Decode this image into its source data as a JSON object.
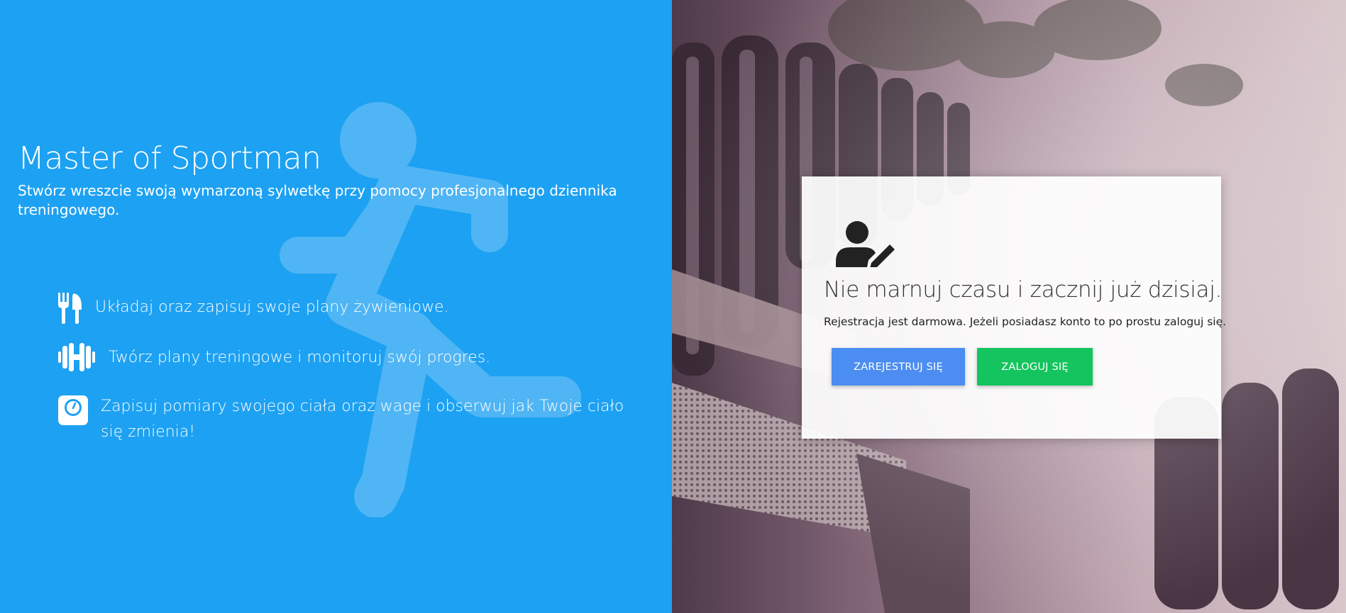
{
  "hero": {
    "title": "Master of Sportman",
    "subtitle": "Stwórz wreszcie swoją wymarzoną sylwetkę przy pomocy profesjonalnego dziennika treningowego."
  },
  "features": [
    {
      "icon": "cutlery-icon",
      "text": "Układaj oraz zapisuj swoje plany żywieniowe."
    },
    {
      "icon": "dumbbell-icon",
      "text": "Twórz plany treningowe i monitoruj swój progres."
    },
    {
      "icon": "weight-scale-icon",
      "text": "Zapisuj pomiary swojego ciała oraz wage i obserwuj jak Twoje ciało się zmienia!"
    }
  ],
  "card": {
    "icon": "user-edit-icon",
    "title": "Nie marnuj czasu i zacznij już dzisiaj.",
    "text": "Rejestracja jest darmowa. Jeżeli posiadasz konto to po prostu zaloguj się.",
    "register_label": "ZAREJESTRUJ SIĘ",
    "login_label": "ZALOGUJ SIĘ"
  },
  "colors": {
    "left_background": "#1da1f2",
    "register_button": "#4b8df1",
    "login_button": "#14c45e"
  }
}
